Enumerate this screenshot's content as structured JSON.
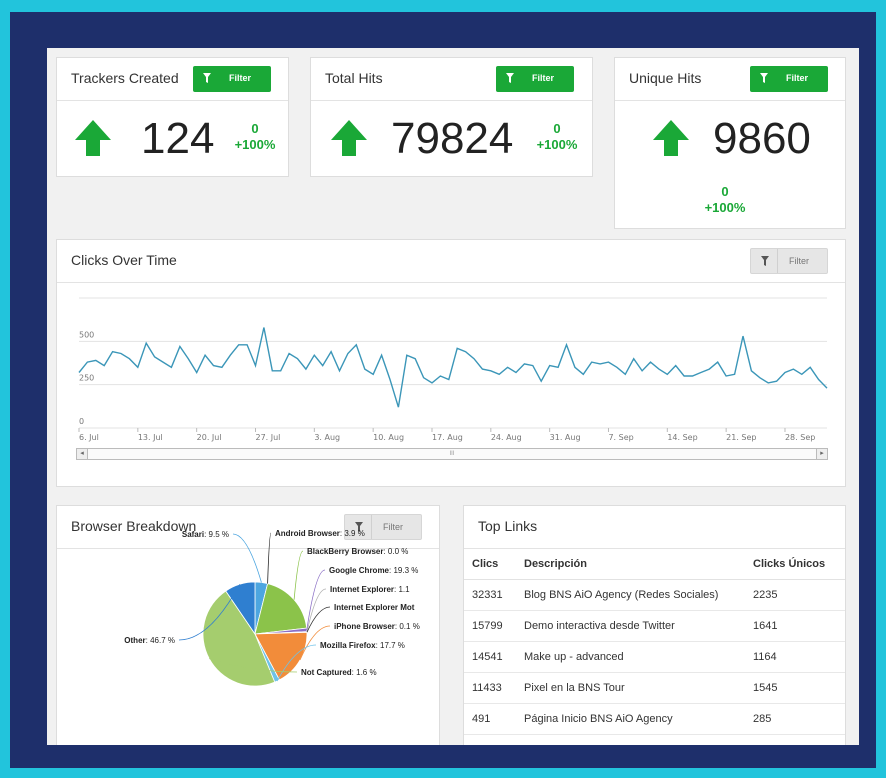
{
  "stats": [
    {
      "title": "Trackers Created",
      "filter_label": "Filter",
      "value": "124",
      "delta_top": "0",
      "delta_bottom": "+100%"
    },
    {
      "title": "Total Hits",
      "filter_label": "Filter",
      "value": "79824",
      "delta_top": "0",
      "delta_bottom": "+100%"
    },
    {
      "title": "Unique Hits",
      "filter_label": "Filter",
      "value": "9860",
      "delta_top": "0",
      "delta_bottom": "+100%"
    }
  ],
  "colors": {
    "accent_green": "#1aa837",
    "line": "#3b96b8",
    "frame": "#22c4dc",
    "background": "#1e2f6b"
  },
  "clicks_panel": {
    "title": "Clicks Over Time",
    "filter_label": "Filter",
    "scroll_mid": "III"
  },
  "chart_data": [
    {
      "type": "line",
      "title": "Clicks Over Time",
      "yticks": [
        "0",
        "250",
        "500"
      ],
      "ylim": [
        0,
        750
      ],
      "x_ticks": [
        "6. Jul",
        "13. Jul",
        "20. Jul",
        "27. Jul",
        "3. Aug",
        "10. Aug",
        "17. Aug",
        "24. Aug",
        "31. Aug",
        "7. Sep",
        "14. Sep",
        "21. Sep",
        "28. Sep"
      ],
      "grid": true,
      "values": [
        320,
        380,
        390,
        360,
        440,
        430,
        400,
        350,
        490,
        410,
        380,
        350,
        470,
        400,
        320,
        420,
        360,
        350,
        420,
        480,
        480,
        360,
        580,
        330,
        330,
        430,
        400,
        340,
        420,
        360,
        440,
        330,
        430,
        480,
        340,
        310,
        420,
        280,
        120,
        420,
        400,
        290,
        260,
        300,
        280,
        460,
        440,
        400,
        340,
        330,
        310,
        350,
        320,
        370,
        360,
        270,
        360,
        350,
        480,
        350,
        310,
        380,
        370,
        380,
        350,
        310,
        400,
        330,
        380,
        340,
        310,
        360,
        300,
        300,
        320,
        340,
        380,
        300,
        310,
        530,
        330,
        290,
        260,
        270,
        320,
        340,
        310,
        350,
        280,
        230
      ]
    },
    {
      "type": "pie",
      "title": "Browser Breakdown",
      "slices": [
        {
          "name": "Android Browser",
          "value": 3.9,
          "color": "#4da6e0"
        },
        {
          "name": "BlackBerry Browser",
          "value": 0.0,
          "color": "#222222"
        },
        {
          "name": "Google Chrome",
          "value": 19.3,
          "color": "#8bc34a"
        },
        {
          "name": "Internet Explorer",
          "value": 1.1,
          "color": "#8b6fc6"
        },
        {
          "name": "Internet Explorer Mob",
          "value": 0.1,
          "color": "#b0b0b0"
        },
        {
          "name": "iPhone Browser",
          "value": 0.1,
          "color": "#333333"
        },
        {
          "name": "Mozilla Firefox",
          "value": 17.7,
          "color": "#f28c3a"
        },
        {
          "name": "Not Captured",
          "value": 1.6,
          "color": "#6ec2e8"
        },
        {
          "name": "Other",
          "value": 46.7,
          "color": "#a5cd6e"
        },
        {
          "name": "Safari",
          "value": 9.5,
          "color": "#2f7fd0"
        }
      ]
    }
  ],
  "browser_panel": {
    "title": "Browser Breakdown",
    "filter_label": "Filter",
    "labels": [
      {
        "name": "Safari",
        "pct": ": 9.5 %"
      },
      {
        "name": "Android Browser",
        "pct": ": 3.9 %"
      },
      {
        "name": "BlackBerry Browser",
        "pct": ": 0.0 %"
      },
      {
        "name": "Google Chrome",
        "pct": ": 19.3 %"
      },
      {
        "name": "Internet Explorer",
        "pct": ": 1.1"
      },
      {
        "name": "Internet Explorer Mot",
        "pct": ""
      },
      {
        "name": "iPhone Browser",
        "pct": ": 0.1 %"
      },
      {
        "name": "Mozilla Firefox",
        "pct": ": 17.7 %"
      },
      {
        "name": "Not Captured",
        "pct": ": 1.6 %"
      },
      {
        "name": "Other",
        "pct": ": 46.7 %"
      }
    ]
  },
  "top_links": {
    "title": "Top Links",
    "headers": [
      "Clics",
      "Descripción",
      "Clicks Únicos"
    ],
    "rows": [
      [
        "32331",
        "Blog BNS AiO Agency (Redes Sociales)",
        "2235"
      ],
      [
        "15799",
        "Demo interactiva desde Twitter",
        "1641"
      ],
      [
        "14541",
        "Make up - advanced",
        "1164"
      ],
      [
        "11433",
        "Pixel en la BNS Tour",
        "1545"
      ],
      [
        "491",
        "Página Inicio BNS AiO Agency",
        "285"
      ]
    ]
  }
}
